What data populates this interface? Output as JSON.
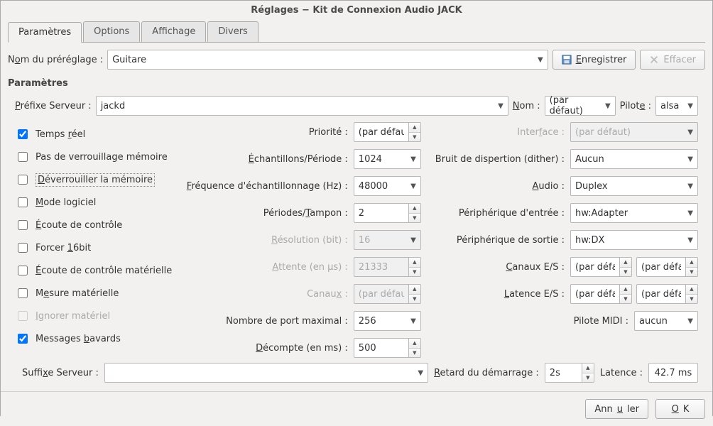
{
  "window_title": "Réglages − Kit de Connexion Audio JACK",
  "tabs": [
    "Paramètres",
    "Options",
    "Affichage",
    "Divers"
  ],
  "active_tab": "Paramètres",
  "preset": {
    "label_pre": "N",
    "label_u": "o",
    "label_post": "m du préréglage :",
    "value": "Guitare",
    "save_btn": "Enregistrer",
    "delete_btn": "Effacer"
  },
  "section_title": "Paramètres",
  "server_prefix": {
    "label_pre": "",
    "label_u": "P",
    "label_post": "réfixe Serveur :",
    "value": "jackd"
  },
  "name": {
    "label_pre": "",
    "label_u": "N",
    "label_post": "om :",
    "value": "(par défaut)"
  },
  "driver": {
    "label_pre": "Pilot",
    "label_u": "e",
    "label_post": " :",
    "value": "alsa"
  },
  "checks": {
    "realtime": {
      "checked": true,
      "pre": "Temps ",
      "u": "r",
      "post": "éel"
    },
    "nomemlock": {
      "checked": false,
      "pre": "Pas de verrouillage mémoire",
      "u": "",
      "post": ""
    },
    "unlockmem": {
      "checked": false,
      "pre": "",
      "u": "D",
      "post": "éverrouiller la mémoire",
      "boxed": true
    },
    "softmode": {
      "checked": false,
      "pre": "",
      "u": "M",
      "post": "ode logiciel"
    },
    "monitor": {
      "checked": false,
      "pre": "",
      "u": "É",
      "post": "coute de contrôle"
    },
    "force16": {
      "checked": false,
      "pre": "Forcer ",
      "u": "1",
      "post": "6bit"
    },
    "hwmon": {
      "checked": false,
      "pre": "",
      "u": "É",
      "post": "coute de contrôle matérielle"
    },
    "hwmeter": {
      "checked": false,
      "pre": "M",
      "u": "e",
      "post": "sure matérielle"
    },
    "ignorehw": {
      "checked": false,
      "pre": "",
      "u": "I",
      "post": "gnorer matériel",
      "disabled": true
    },
    "verbose": {
      "checked": true,
      "pre": "Messages ",
      "u": "b",
      "post": "avards"
    }
  },
  "mid": {
    "priority": {
      "label": "Priorité :",
      "value": "(par défaut)",
      "type": "spin"
    },
    "frames": {
      "pre": "",
      "u": "É",
      "post": "chantillons/Période :",
      "value": "1024",
      "type": "combo"
    },
    "srate": {
      "pre": "",
      "u": "F",
      "post": "réquence d'échantillonnage (Hz) :",
      "value": "48000",
      "type": "combo"
    },
    "periods": {
      "pre": "Périodes/",
      "u": "T",
      "post": "ampon :",
      "value": "2",
      "type": "spin"
    },
    "res": {
      "pre": "",
      "u": "R",
      "post": "ésolution (bit) :",
      "value": "16",
      "type": "combo",
      "disabled": true
    },
    "wait": {
      "pre": "",
      "u": "A",
      "post": "ttente (en µs) :",
      "value": "21333",
      "type": "spin",
      "disabled": true
    },
    "channels": {
      "pre": "Canau",
      "u": "x",
      "post": " :",
      "value": "(par défaut)",
      "type": "spin",
      "disabled": true
    },
    "maxport": {
      "label": "Nombre de port maximal :",
      "value": "256",
      "type": "combo"
    },
    "countdown": {
      "pre": "",
      "u": "D",
      "post": "écompte (en ms) :",
      "value": "500",
      "type": "spin"
    }
  },
  "right": {
    "interface": {
      "pre": "Inter",
      "u": "f",
      "post": "ace :",
      "value": "(par défaut)",
      "disabled": true
    },
    "dither": {
      "label": "Bruit de dispertion (dither) :",
      "value": "Aucun"
    },
    "audio": {
      "pre": "",
      "u": "A",
      "post": "udio :",
      "value": "Duplex"
    },
    "input_dev": {
      "label": "Périphérique d'entrée :",
      "value": "hw:Adapter"
    },
    "output_dev": {
      "label": "Périphérique de sortie :",
      "value": "hw:DX"
    },
    "io_chan": {
      "pre": "",
      "u": "C",
      "post": "anaux E/S :",
      "v1": "(par défaut)",
      "v2": "(par défaut)"
    },
    "io_lat": {
      "pre": "",
      "u": "L",
      "post": "atence E/S :",
      "v1": "(par défaut)",
      "v2": "(par défaut)"
    },
    "midi": {
      "label": "Pilote MIDI :",
      "value": "aucun"
    }
  },
  "suffix": {
    "pre": "Suffi",
    "u": "x",
    "post": "e Serveur :",
    "value": ""
  },
  "startup_delay": {
    "pre": "",
    "u": "R",
    "post": "etard du démarrage :",
    "value": "2s"
  },
  "latency": {
    "label": "Latence :",
    "value": "42.7 ms"
  },
  "footer": {
    "cancel": "Annuler",
    "ok": "OK",
    "ok_u": "O",
    "ok_post": "K",
    "cancel_pre": "Ann",
    "cancel_u": "u",
    "cancel_post": "ler"
  }
}
